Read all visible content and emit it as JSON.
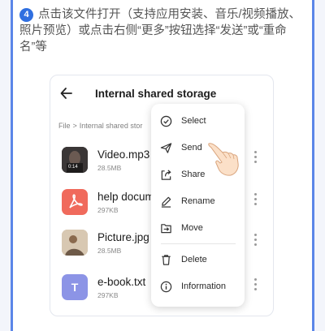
{
  "instruction": {
    "step_number": "4",
    "text": "点击该文件打开（支持应用安装、音乐/视频播放、照片预览）或点击右侧“更多”按钮选择“发送”或“重命名”等"
  },
  "screen": {
    "title": "Internal shared storage",
    "breadcrumb": {
      "root": "File",
      "separator": ">",
      "current": "Internal shared stor"
    },
    "files": [
      {
        "name": "Video.mp3",
        "size": "28.5MB",
        "type": "video",
        "duration": "0:14"
      },
      {
        "name": "help docum",
        "size": "297KB",
        "type": "pdf"
      },
      {
        "name": "Picture.jpg",
        "size": "28.5MB",
        "type": "image"
      },
      {
        "name": "e-book.txt",
        "size": "297KB",
        "type": "text",
        "badge": "T"
      }
    ],
    "context_menu": [
      {
        "label": "Select",
        "icon": "check-circle-icon"
      },
      {
        "label": "Send",
        "icon": "send-icon"
      },
      {
        "label": "Share",
        "icon": "share-icon"
      },
      {
        "label": "Rename",
        "icon": "pencil-icon"
      },
      {
        "label": "Move",
        "icon": "move-icon"
      },
      {
        "label": "Delete",
        "icon": "trash-icon"
      },
      {
        "label": "Information",
        "icon": "info-icon"
      }
    ]
  },
  "colors": {
    "accent": "#2f6fe0",
    "frame_border": "#5b86e8",
    "pdf_red": "#f06a5c",
    "text_file_purple": "#8c94e6"
  }
}
